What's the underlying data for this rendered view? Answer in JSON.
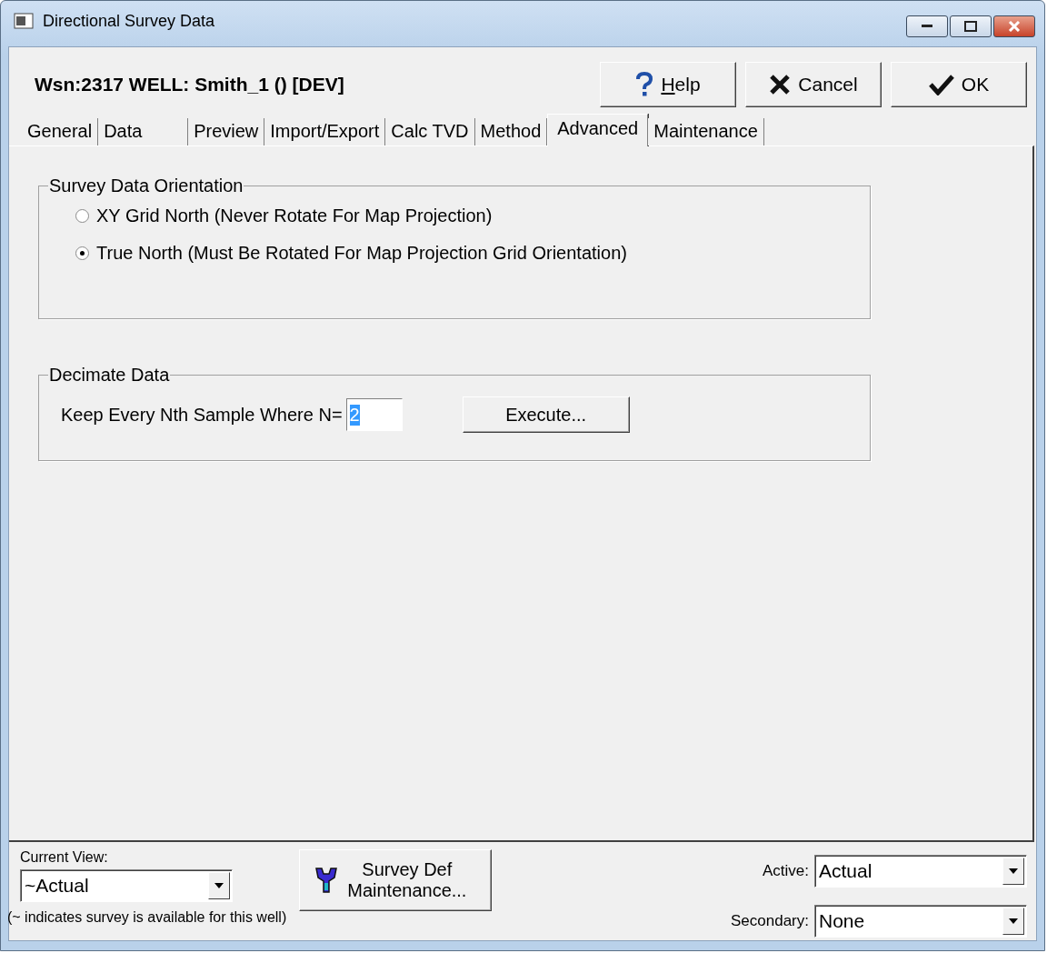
{
  "window": {
    "title": "Directional Survey Data"
  },
  "header": {
    "well_label": "Wsn:2317 WELL: Smith_1 () [DEV]"
  },
  "buttons": [
    {
      "kind": "help",
      "label": "Help"
    },
    {
      "kind": "cancel",
      "label": "Cancel"
    },
    {
      "kind": "ok",
      "label": "OK"
    }
  ],
  "tabs": [
    {
      "label": "General",
      "selected": false
    },
    {
      "label": "Data",
      "selected": false
    },
    {
      "label": "Preview",
      "selected": false
    },
    {
      "label": "Import/Export",
      "selected": false
    },
    {
      "label": "Calc TVD",
      "selected": false
    },
    {
      "label": "Method",
      "selected": false
    },
    {
      "label": "Advanced",
      "selected": true
    },
    {
      "label": "Maintenance",
      "selected": false
    }
  ],
  "orientation_group": {
    "title": "Survey Data Orientation",
    "options": [
      {
        "label": "XY Grid North (Never Rotate For Map Projection)",
        "selected": false
      },
      {
        "label": "True North (Must Be Rotated For Map Projection Grid Orientation)",
        "selected": true
      }
    ]
  },
  "decimate_group": {
    "title": "Decimate Data",
    "label": "Keep Every Nth Sample Where N=",
    "value": "2",
    "highlighted": true,
    "button": "Execute..."
  },
  "footer": {
    "current_view_label": "Current View:",
    "current_view": "~Actual",
    "survey_def_button": [
      "Survey Def",
      "Maintenance..."
    ],
    "note": "(~ indicates survey is available for this well)",
    "active_label": "Active:",
    "active": "Actual",
    "secondary_label": "Secondary:",
    "secondary": "None"
  }
}
